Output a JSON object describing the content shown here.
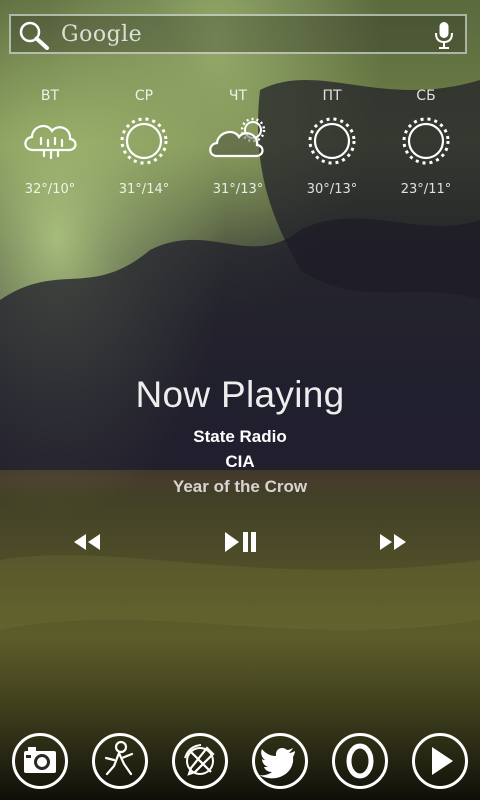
{
  "search": {
    "label": "Google"
  },
  "weather": [
    {
      "day": "ВТ",
      "temp": "32°/10°",
      "icon": "rain-cloud-icon"
    },
    {
      "day": "СР",
      "temp": "31°/14°",
      "icon": "sun-icon"
    },
    {
      "day": "ЧТ",
      "temp": "31°/13°",
      "icon": "partly-cloudy-icon"
    },
    {
      "day": "ПТ",
      "temp": "30°/13°",
      "icon": "sun-icon"
    },
    {
      "day": "СБ",
      "temp": "23°/11°",
      "icon": "sun-icon"
    }
  ],
  "now_playing": {
    "title": "Now Playing",
    "artist": "State Radio",
    "song": "CIA",
    "album": "Year of the Crow"
  },
  "controls": [
    "rewind-icon",
    "play-pause-icon",
    "fast-forward-icon"
  ],
  "dock": [
    "camera-icon",
    "aim-icon",
    "tools-icon",
    "twitter-icon",
    "opera-icon",
    "play-store-icon"
  ]
}
